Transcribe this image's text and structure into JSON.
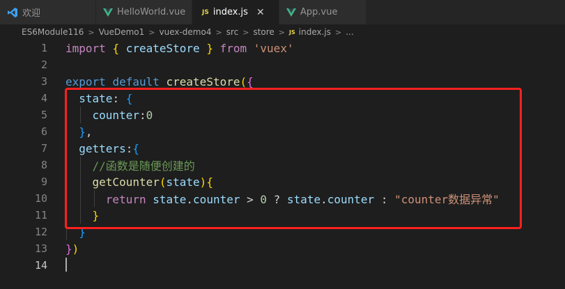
{
  "tabs": [
    {
      "label": "欢迎",
      "icon": "vscode-icon",
      "active": false
    },
    {
      "label": "HelloWorld.vue",
      "icon": "vue-icon",
      "active": false
    },
    {
      "label": "index.js",
      "icon": "js-icon",
      "active": true,
      "badge": "JS"
    },
    {
      "label": "App.vue",
      "icon": "vue-icon",
      "active": false
    }
  ],
  "breadcrumb": {
    "items": [
      "ES6Module116",
      "VueDemo1",
      "vuex-demo4",
      "src",
      "store"
    ],
    "file_badge": "JS",
    "file": "index.js",
    "trailing": "..."
  },
  "lines": [
    "1",
    "2",
    "3",
    "4",
    "5",
    "6",
    "7",
    "8",
    "9",
    "10",
    "11",
    "12",
    "13",
    "14"
  ],
  "code": {
    "l1": {
      "kw": "import",
      "b1": "{",
      "name": "createStore",
      "b2": "}",
      "from": "from",
      "str": "'vuex'"
    },
    "l3": {
      "export": "export",
      "default": "default",
      "fn": "createStore",
      "p": "(",
      "b": "{"
    },
    "l4": {
      "key": "state",
      "colon": ":",
      "b": "{"
    },
    "l5": {
      "key": "counter",
      "colon": ":",
      "num": "0"
    },
    "l6": {
      "b": "}",
      "comma": ","
    },
    "l7": {
      "key": "getters",
      "colon": ":",
      "b": "{"
    },
    "l8": {
      "comment": "//函数是随便创建的"
    },
    "l9": {
      "fn": "getCounter",
      "p1": "(",
      "arg": "state",
      "p2": ")",
      "b": "{"
    },
    "l10": {
      "ret": "return",
      "obj1": "state",
      "dot1": ".",
      "prop1": "counter",
      "op1": " > ",
      "num": "0",
      "op2": " ? ",
      "obj2": "state",
      "dot2": ".",
      "prop2": "counter",
      "op3": " : ",
      "str": "\"counter数据异常\""
    },
    "l11": {
      "b": "}"
    },
    "l12": {
      "b": "}"
    },
    "l13": {
      "b": "}",
      "p": ")"
    }
  }
}
